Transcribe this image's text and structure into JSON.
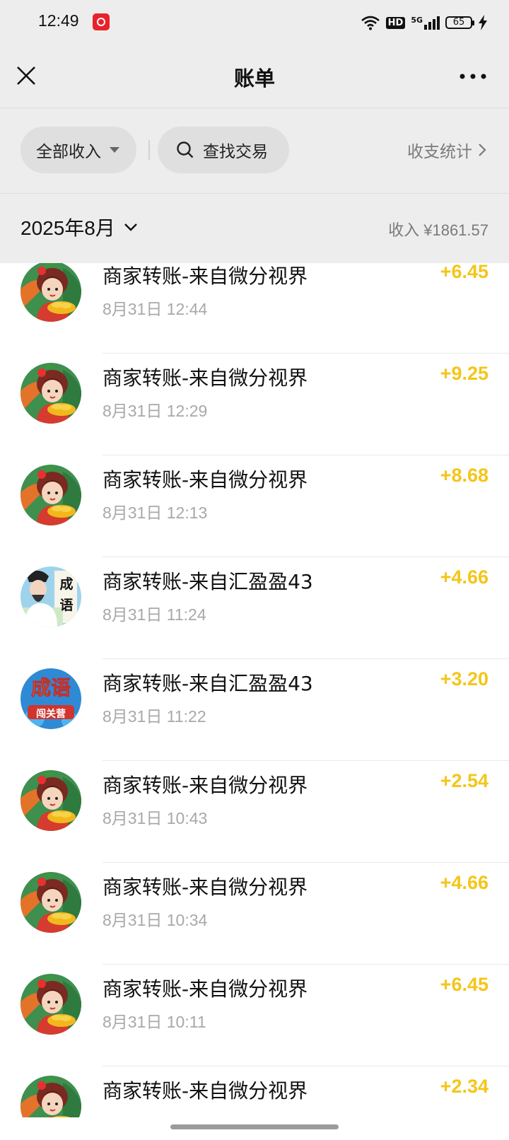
{
  "status_bar": {
    "time": "12:49",
    "hd_label": "HD",
    "network_label": "5G",
    "battery": "65"
  },
  "header": {
    "title": "账单"
  },
  "filters": {
    "all_income": "全部收入",
    "search": "查找交易",
    "stats": "收支统计"
  },
  "summary": {
    "month": "2025年8月",
    "income": "收入 ¥1861.57"
  },
  "colors": {
    "amount": "#f5c518",
    "background": "#ededed"
  },
  "transactions": [
    {
      "title": "商家转账-来自微分视界",
      "time": "8月31日 12:44",
      "amount": "+6.45",
      "avatar": "girl-avatar"
    },
    {
      "title": "商家转账-来自微分视界",
      "time": "8月31日 12:29",
      "amount": "+9.25",
      "avatar": "girl-avatar"
    },
    {
      "title": "商家转账-来自微分视界",
      "time": "8月31日 12:13",
      "amount": "+8.68",
      "avatar": "girl-avatar"
    },
    {
      "title": "商家转账-来自汇盈盈43",
      "time": "8月31日 11:24",
      "amount": "+4.66",
      "avatar": "scholar-avatar",
      "avatar_text": [
        "成",
        "语"
      ]
    },
    {
      "title": "商家转账-来自汇盈盈43",
      "time": "8月31日 11:22",
      "amount": "+3.20",
      "avatar": "idiom-game-avatar",
      "avatar_text": [
        "成语",
        "闯关营"
      ]
    },
    {
      "title": "商家转账-来自微分视界",
      "time": "8月31日 10:43",
      "amount": "+2.54",
      "avatar": "girl-avatar"
    },
    {
      "title": "商家转账-来自微分视界",
      "time": "8月31日 10:34",
      "amount": "+4.66",
      "avatar": "girl-avatar"
    },
    {
      "title": "商家转账-来自微分视界",
      "time": "8月31日 10:11",
      "amount": "+6.45",
      "avatar": "girl-avatar"
    },
    {
      "title": "商家转账-来自微分视界",
      "time": "",
      "amount": "+2.34",
      "avatar": "girl-avatar"
    }
  ]
}
